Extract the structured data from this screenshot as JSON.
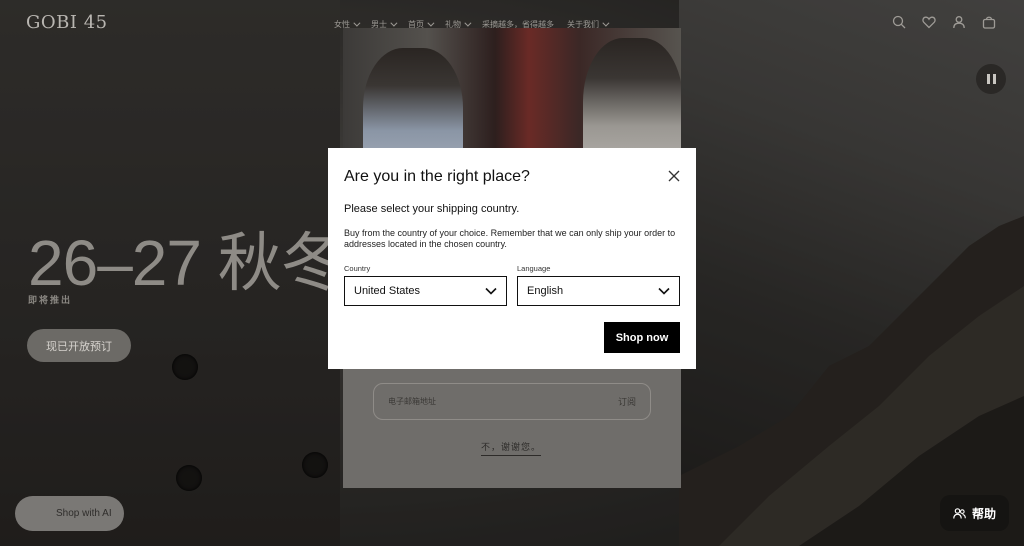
{
  "header": {
    "logo": "GOBI 45",
    "nav": [
      {
        "label": "女性"
      },
      {
        "label": "男士"
      },
      {
        "label": "首页"
      },
      {
        "label": "礼物"
      },
      {
        "label": "采摘越多，省得越多"
      },
      {
        "label": "关于我们"
      }
    ],
    "icons": [
      "search-icon",
      "heart-icon",
      "user-icon",
      "bag-icon"
    ]
  },
  "hero": {
    "title": "26–27 秋冬",
    "subtitle": "即将推出",
    "cta": "现已开放预订"
  },
  "newsletter": {
    "email_placeholder": "电子邮箱地址",
    "subscribe": "订阅",
    "decline": "不，谢谢您。"
  },
  "modal": {
    "title": "Are you in the right place?",
    "subtitle": "Please select your shipping country.",
    "description": "Buy from the country of your choice. Remember that we can only ship your order to addresses located in the chosen country.",
    "country_label": "Country",
    "country_value": "United States",
    "language_label": "Language",
    "language_value": "English",
    "submit": "Shop now"
  },
  "floating": {
    "ai_button": "Shop with AI",
    "help_button": "帮助"
  },
  "colors": {
    "modal_bg": "#ffffff",
    "primary_button": "#000000"
  }
}
